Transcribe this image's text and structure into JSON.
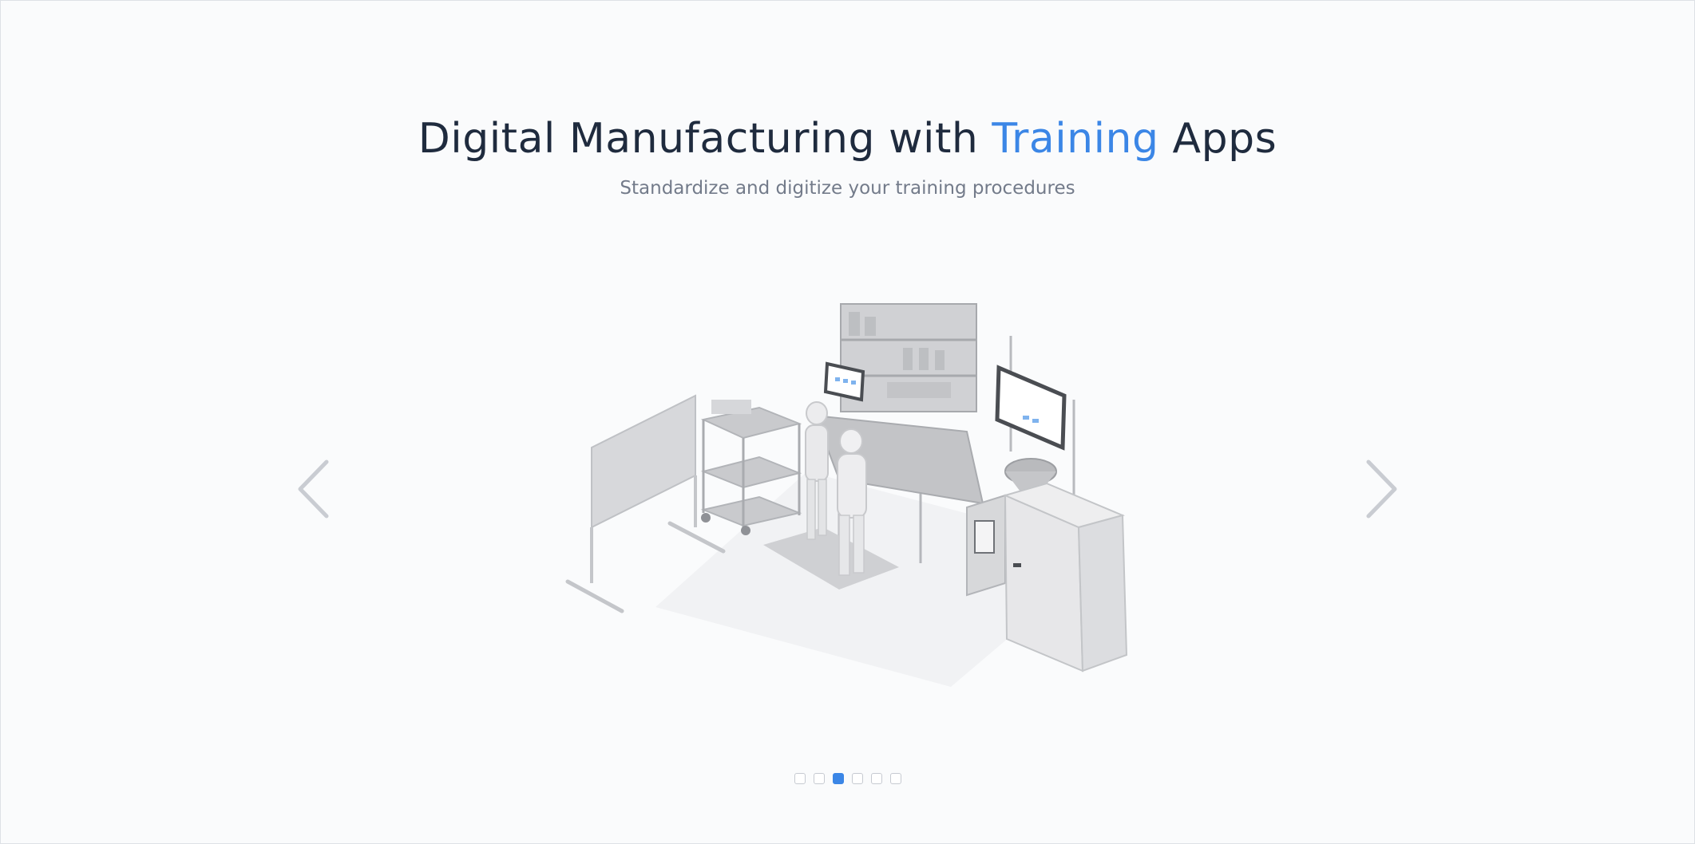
{
  "hero": {
    "title_part1": "Digital Manufacturing with ",
    "title_accent": "Training",
    "title_part2": " Apps",
    "subtitle": "Standardize and digitize your training procedures"
  },
  "carousel": {
    "prev_icon": "chevron-left-icon",
    "next_icon": "chevron-right-icon",
    "slide_count": 6,
    "active_index": 2
  },
  "colors": {
    "accent": "#3b86e6",
    "heading": "#1f2b3e",
    "subtitle": "#737b8a",
    "arrow": "#c9ccd2"
  }
}
